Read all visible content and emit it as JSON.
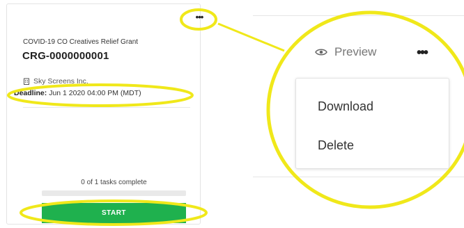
{
  "card": {
    "menu_glyph": "•••",
    "program_name": "COVID-19 CO Creatives Relief Grant",
    "grant_id": "CRG-0000000001",
    "organization": "Sky Screens Inc.",
    "deadline_label": "Deadline:",
    "deadline_value": "Jun 1 2020 04:00 PM (MDT)",
    "tasks_status": "0 of 1 tasks complete",
    "progress_fraction": 0,
    "start_label": "START"
  },
  "zoom": {
    "preview_label": "Preview",
    "more_glyph": "•••",
    "menu_items": [
      "Download",
      "Delete"
    ]
  },
  "colors": {
    "accent_green": "#1fb14e",
    "highlight_yellow": "#f0e81a"
  },
  "icons": [
    "more-options-icon",
    "building-icon",
    "eye-icon"
  ]
}
